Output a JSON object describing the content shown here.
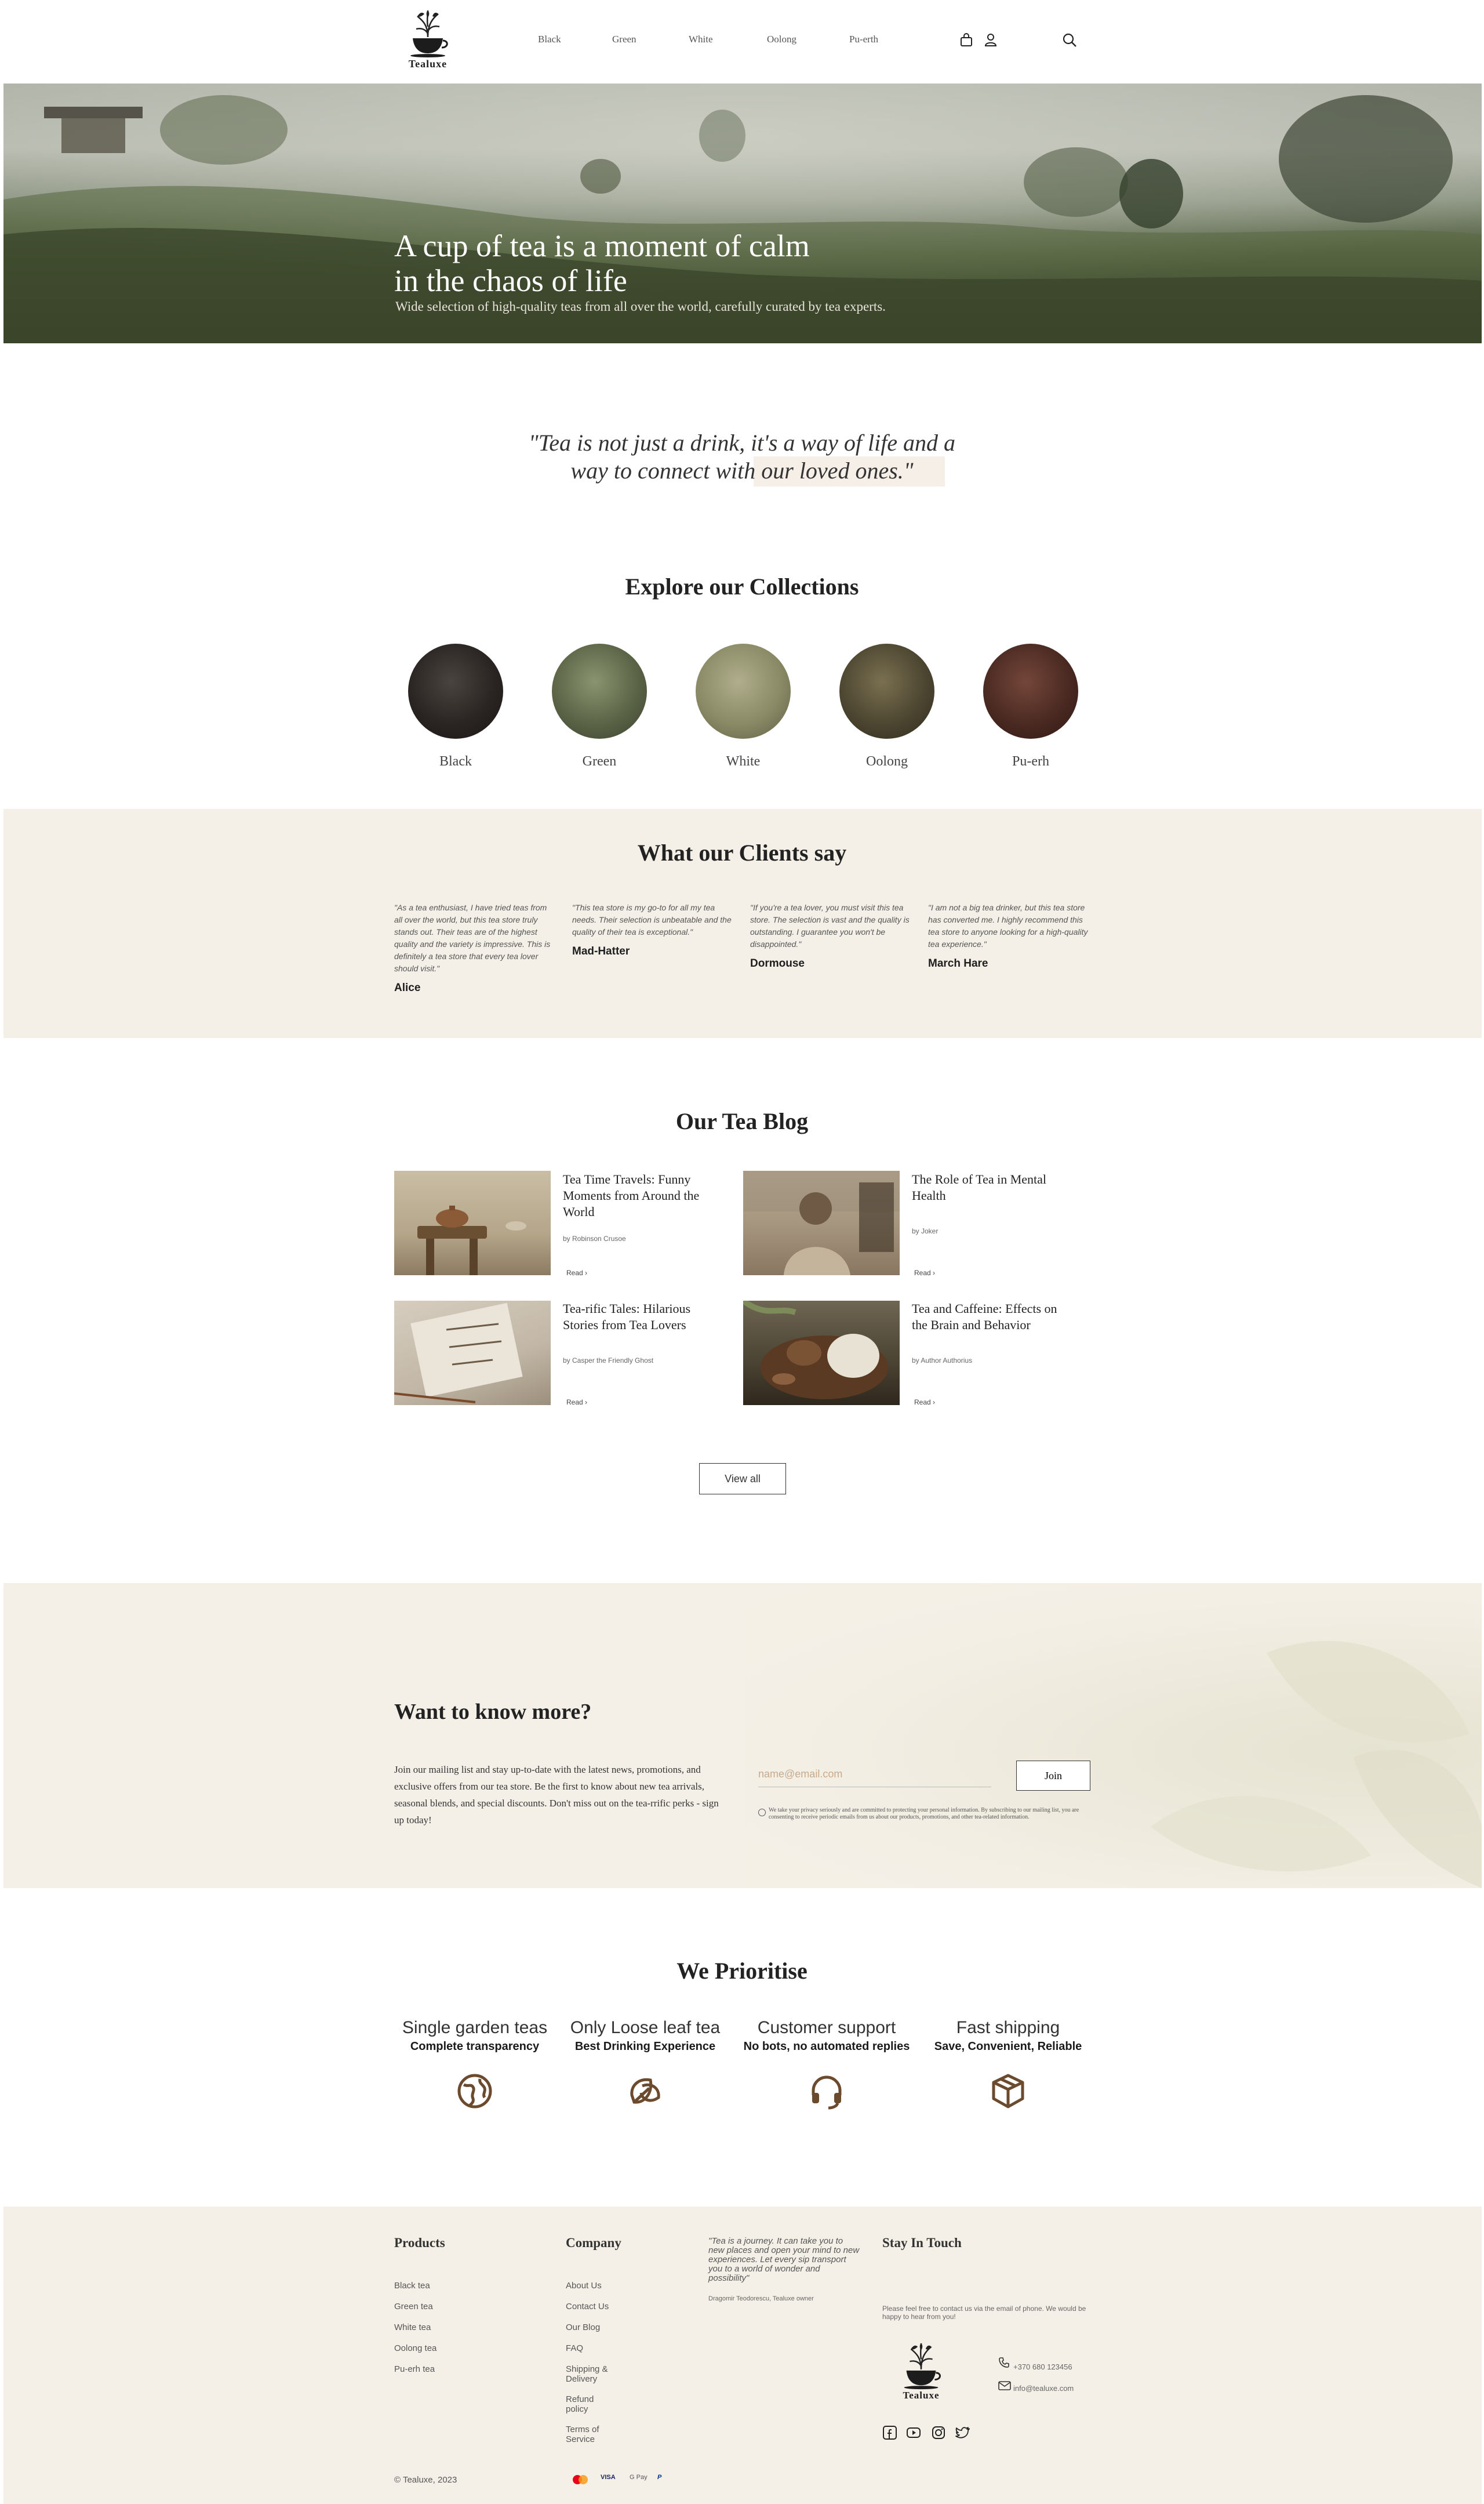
{
  "header": {
    "brand": "Tealuxe",
    "nav": [
      "Black",
      "Green",
      "White",
      "Oolong",
      "Pu-erth"
    ],
    "icons": [
      "bag-icon",
      "user-icon",
      "search-icon"
    ]
  },
  "hero": {
    "title_line1": "A cup of tea is a moment of calm",
    "title_line2": "in the chaos of life",
    "subtitle": "Wide selection of high-quality teas from all over the world, carefully curated by tea experts."
  },
  "quote": {
    "text": "\"Tea is not just a drink, it's a way of life and a way to connect with our loved ones.\""
  },
  "collections": {
    "title": "Explore our Collections",
    "items": [
      {
        "label": "Black",
        "color": "#2a2522"
      },
      {
        "label": "Green",
        "color": "#5b6446"
      },
      {
        "label": "White",
        "color": "#8a8a66"
      },
      {
        "label": "Oolong",
        "color": "#4d4631"
      },
      {
        "label": "Pu-erh",
        "color": "#4a2a22"
      }
    ]
  },
  "testimonials": {
    "title": "What our Clients say",
    "items": [
      {
        "text": "\"As a tea enthusiast, I have tried teas from all over the world, but this tea store truly stands out. Their teas are of the highest quality and the variety is impressive. This is definitely a tea store that every tea lover should visit.\"",
        "name": "Alice"
      },
      {
        "text": "\"This tea store is my go-to for all my tea needs. Their selection is unbeatable and the quality of their tea is exceptional.\"",
        "name": "Mad-Hatter"
      },
      {
        "text": "\"If you're a tea lover, you must visit this tea store. The selection is vast and the quality is outstanding. I guarantee you won't be disappointed.\"",
        "name": "Dormouse"
      },
      {
        "text": "\"I am not a big tea drinker, but this tea store has converted me. I highly recommend this tea store to anyone looking for a high-quality tea experience.\"",
        "name": "March Hare"
      }
    ]
  },
  "blog": {
    "title": "Our Tea Blog",
    "read_label": "Read",
    "view_all": "View all",
    "posts": [
      {
        "title": "Tea Time Travels: Funny Moments from Around the World",
        "author": "by Robinson Crusoe"
      },
      {
        "title": "The Role of Tea in Mental Health",
        "author": "by Joker"
      },
      {
        "title": "Tea-rific Tales: Hilarious Stories from Tea Lovers",
        "author": "by Casper the Friendly Ghost"
      },
      {
        "title": "Tea and Caffeine: Effects on the Brain and Behavior",
        "author": "by Author Authorius"
      }
    ]
  },
  "newsletter": {
    "title": "Want to know more?",
    "body": "Join our mailing list and stay up-to-date with the latest news, promotions, and exclusive offers from our tea store. Be the first to know about new tea arrivals, seasonal blends, and special discounts. Don't miss out on the tea-rrific perks - sign up today!",
    "email_placeholder": "name@email.com",
    "join_label": "Join",
    "consent": "We take your privacy seriously and are committed to protecting your personal information. By subscribing to our mailing list, you are consenting to receive periodic emails from us about our products, promotions, and other tea-related information."
  },
  "priorities": {
    "title": "We Prioritise",
    "items": [
      {
        "heading": "Single garden teas",
        "sub": "Complete transparency",
        "icon": "globe-icon"
      },
      {
        "heading": "Only Loose leaf tea",
        "sub": "Best Drinking Experience",
        "icon": "leaf-icon"
      },
      {
        "heading": "Customer support",
        "sub": "No bots, no automated replies",
        "icon": "headphones-icon"
      },
      {
        "heading": "Fast shipping",
        "sub": "Save, Convenient, Reliable",
        "icon": "box-icon"
      }
    ]
  },
  "footer": {
    "products_title": "Products",
    "products": [
      "Black tea",
      "Green tea",
      "White tea",
      "Oolong tea",
      "Pu-erh tea"
    ],
    "company_title": "Company",
    "company": [
      "About Us",
      "Contact Us",
      "Our Blog",
      "FAQ",
      "Shipping & Delivery",
      "Refund policy",
      "Terms of Service"
    ],
    "quote": "\"Tea is a journey. It can take you to new places and open your mind to new experiences. Let every sip transport you to a world of wonder and possibility\"",
    "quote_by": "Dragomir Teodorescu, Tealuxe owner",
    "contact_title": "Stay In Touch",
    "contact_text": "Please feel free to contact us via the email of phone. We would be happy to hear from you!",
    "brand": "Tealuxe",
    "phone": "+370 680 123456",
    "email": "info@tealuxe.com",
    "copyright": "© Tealuxe, 2023",
    "payments": [
      "Mastercard",
      "VISA",
      "G Pay",
      "P"
    ]
  }
}
